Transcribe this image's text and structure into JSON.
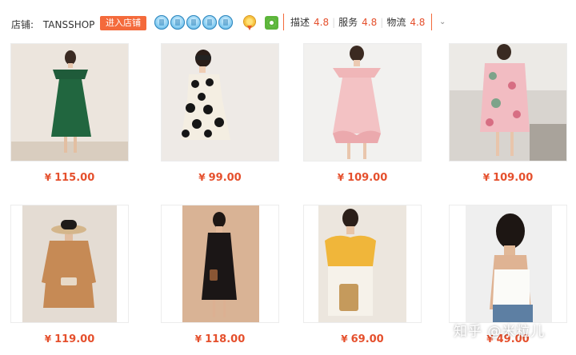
{
  "shop": {
    "label": "店铺:",
    "name": "TANSSHOP",
    "enter_button": "进入店铺",
    "crown_icon": "blue-crown-icon",
    "crown_count": 5,
    "scores": [
      {
        "label": "描述",
        "value": "4.8"
      },
      {
        "label": "服务",
        "value": "4.8"
      },
      {
        "label": "物流",
        "value": "4.8"
      }
    ],
    "expand_icon": "chevron-down-icon"
  },
  "products": [
    {
      "price": "115.00",
      "image": "green-off-shoulder-dress-photo"
    },
    {
      "price": "99.00",
      "image": "polka-dot-dress-photo"
    },
    {
      "price": "109.00",
      "image": "pink-ruffle-dress-photo"
    },
    {
      "price": "109.00",
      "image": "pink-floral-wrap-dress-photo"
    },
    {
      "price": "119.00",
      "image": "tan-dress-straw-hat-photo"
    },
    {
      "price": "118.00",
      "image": "black-slip-dress-photo"
    },
    {
      "price": "69.00",
      "image": "yellow-puff-sleeve-top-photo"
    },
    {
      "price": "49.00",
      "image": "white-tie-back-top-photo"
    }
  ],
  "currency": "¥",
  "watermark": "知乎 @米粒儿",
  "colors": {
    "accent": "#f46a3b",
    "price": "#e5502d"
  }
}
